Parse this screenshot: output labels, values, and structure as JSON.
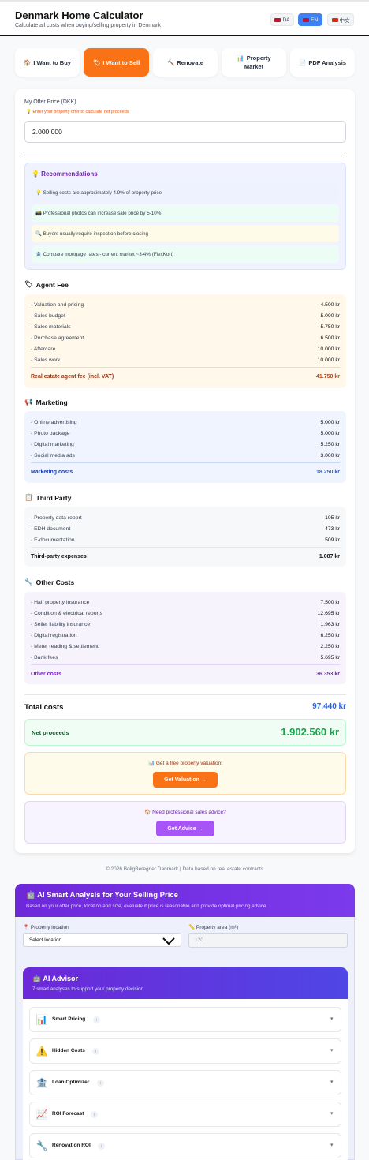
{
  "header": {
    "title": "Denmark Home Calculator",
    "subtitle": "Calculate all costs when buying/selling property in Denmark",
    "languages": [
      {
        "label": "DA",
        "flag_color": "#c8102e",
        "active": false
      },
      {
        "label": "EN",
        "flag_color": "#c8102e",
        "active": true
      },
      {
        "label": "中文",
        "flag_color": "#de2910",
        "active": false
      }
    ]
  },
  "tabs": [
    {
      "icon": "🏠",
      "label": "I Want to Buy"
    },
    {
      "icon": "🏷",
      "label": "I Want to Sell"
    },
    {
      "icon": "🔨",
      "label": "Renovate"
    },
    {
      "icon": "📊",
      "label": "Property Market"
    },
    {
      "icon": "📄",
      "label": "PDF Analysis"
    }
  ],
  "active_tab": "I Want to Sell",
  "offer": {
    "label": "My Offer Price (DKK)",
    "hint": "💡 Enter your property offer to calculate net proceeds",
    "value": "2.000.000"
  },
  "recommendations": {
    "title": "💡 Recommendations",
    "items": [
      {
        "text": "💡 Selling costs are approximately 4.9% of property price",
        "bg": "#eef2ff"
      },
      {
        "text": "📸 Professional photos can increase sale price by 5-10%",
        "bg": "#ecfdf5"
      },
      {
        "text": "🔍 Buyers usually require inspection before closing",
        "bg": "#fefce8"
      },
      {
        "text": "🏦 Compare mortgage rates - current market ~3-4% (FlexKort)",
        "bg": "#ecfdf5"
      }
    ]
  },
  "sections": {
    "agent": {
      "title": "Agent Fee",
      "icon": "🏷",
      "rows": [
        {
          "label": "- Valuation and pricing",
          "amount": "4.500 kr"
        },
        {
          "label": "- Sales budget",
          "amount": "5.000 kr"
        },
        {
          "label": "- Sales materials",
          "amount": "5.750 kr"
        },
        {
          "label": "- Purchase agreement",
          "amount": "6.500 kr"
        },
        {
          "label": "- Aftercare",
          "amount": "10.000 kr"
        },
        {
          "label": "- Sales work",
          "amount": "10.000 kr"
        }
      ],
      "sum_label": "Real estate agent fee (incl. VAT)",
      "sum_amount": "41.750 kr"
    },
    "marketing": {
      "title": "Marketing",
      "icon": "📢",
      "rows": [
        {
          "label": "- Online advertising",
          "amount": "5.000 kr"
        },
        {
          "label": "- Photo package",
          "amount": "5.000 kr"
        },
        {
          "label": "- Digital marketing",
          "amount": "5.250 kr"
        },
        {
          "label": "- Social media ads",
          "amount": "3.000 kr"
        }
      ],
      "sum_label": "Marketing costs",
      "sum_amount": "18.250 kr"
    },
    "third_party": {
      "title": "Third Party",
      "icon": "📋",
      "rows": [
        {
          "label": "- Property data report",
          "amount": "105 kr"
        },
        {
          "label": "- EDH document",
          "amount": "473 kr"
        },
        {
          "label": "- E-documentation",
          "amount": "509 kr"
        }
      ],
      "sum_label": "Third-party expenses",
      "sum_amount": "1.087 kr"
    },
    "other": {
      "title": "Other Costs",
      "icon": "🔧",
      "rows": [
        {
          "label": "- Half property insurance",
          "amount": "7.500 kr"
        },
        {
          "label": "- Condition & electrical reports",
          "amount": "12.695 kr"
        },
        {
          "label": "- Seller liability insurance",
          "amount": "1.963 kr"
        },
        {
          "label": "- Digital registration",
          "amount": "6.250 kr"
        },
        {
          "label": "- Meter reading & settlement",
          "amount": "2.250 kr"
        },
        {
          "label": "- Bank fees",
          "amount": "5.695 kr"
        }
      ],
      "sum_label": "Other costs",
      "sum_amount": "36.353 kr"
    }
  },
  "totals": {
    "total_label": "Total costs",
    "total_value": "97.440 kr",
    "net_label": "Net proceeds",
    "net_value": "1.902.560 kr"
  },
  "cta_valuation": {
    "text": "📊 Get a free property valuation!",
    "button": "Get Valuation →"
  },
  "cta_advice": {
    "text": "🏠 Need professional sales advice?",
    "button": "Get Advice →"
  },
  "footer": "© 2026 BoligBeregner Danmark | Data based on real estate contracts",
  "ai_analysis": {
    "title": "🤖 AI Smart Analysis for Your Selling Price",
    "subtitle": "Based on your offer price, location and size, evaluate if price is reasonable and provide optimal pricing advice",
    "location_label": "📍 Property location",
    "location_value": "Select location",
    "area_label": "📏 Property area (m²)",
    "area_placeholder": "120"
  },
  "advisor": {
    "title": "🤖 AI Advisor",
    "subtitle": "7 smart analyses to support your property decision",
    "items": [
      {
        "icon": "📊",
        "label": "Smart Pricing"
      },
      {
        "icon": "⚠️",
        "label": "Hidden Costs"
      },
      {
        "icon": "🏦",
        "label": "Loan Optimizer"
      },
      {
        "icon": "📈",
        "label": "ROI Forecast"
      },
      {
        "icon": "🔧",
        "label": "Renovation ROI"
      }
    ],
    "badge": "i",
    "chevron": "▾"
  },
  "colors": {
    "accent": "#f97316",
    "agent_bg": "#fff8eb",
    "agent_sum": "#c2410c",
    "marketing_bg": "#eff4ff",
    "marketing_sum": "#2563eb",
    "third_bg": "#f7f8fa",
    "other_bg": "#f7f3fd",
    "other_sum": "#7e22ce",
    "net_green": "#16a34a",
    "advice_purple": "#a855f7"
  }
}
